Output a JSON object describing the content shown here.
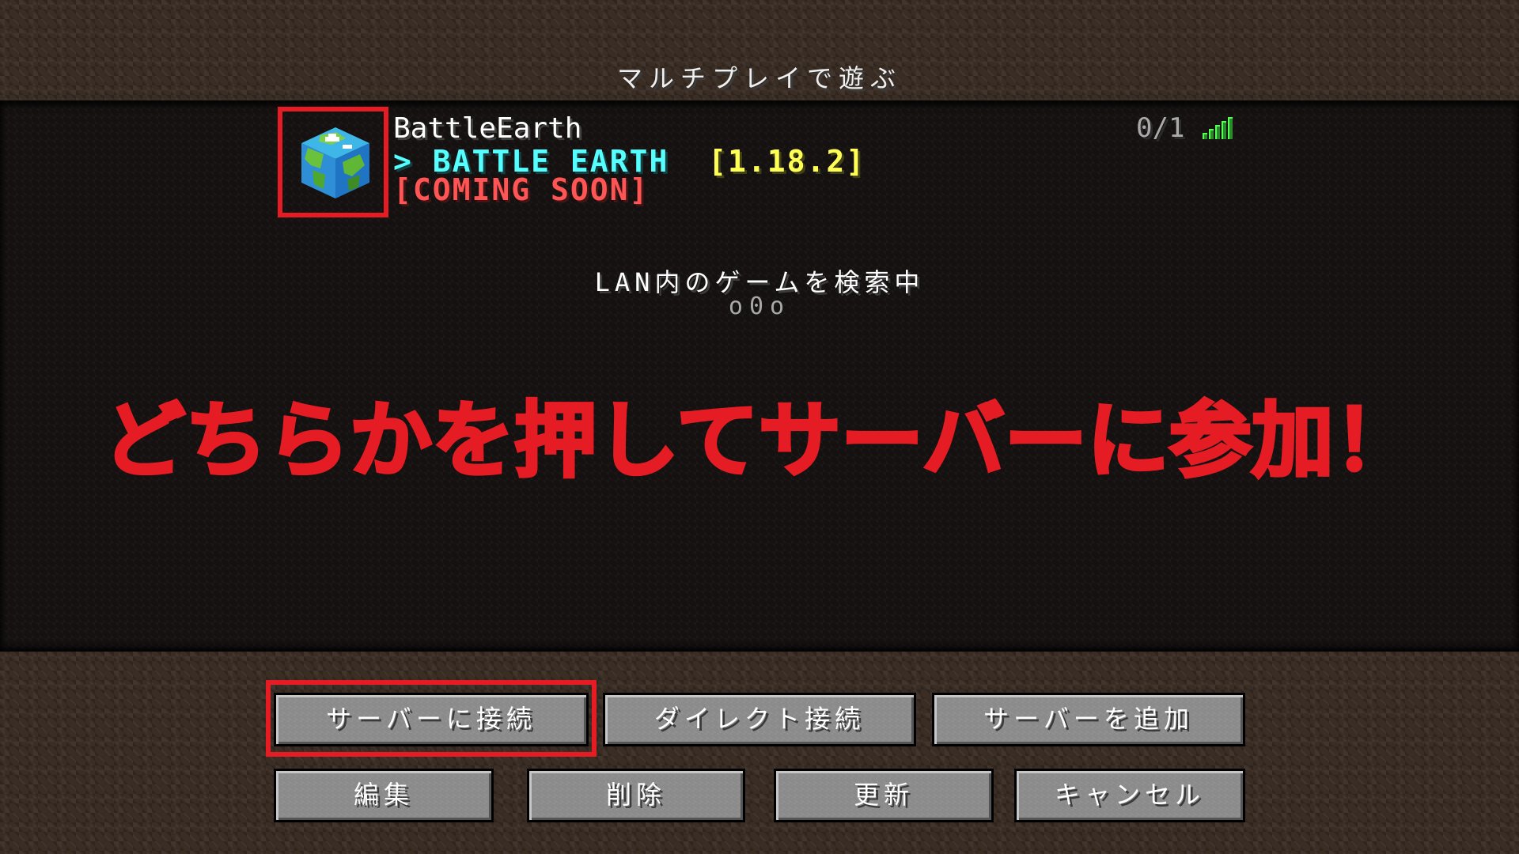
{
  "screen": {
    "title": "マルチプレイで遊ぶ"
  },
  "server_entry": {
    "name": "BattleEarth",
    "motd_arrow": ">",
    "motd_title": "BATTLE EARTH",
    "motd_version": "[1.18.2]",
    "motd_line2": "[COMING SOON]",
    "players": "0/1",
    "icon": "earth-cube-icon",
    "ping_icon": "signal-bars-icon",
    "colors": {
      "motd_aqua": "#55ffff",
      "motd_yellow": "#ffff55",
      "motd_red": "#ff5555",
      "ping_green": "#55ff55"
    }
  },
  "lan": {
    "scanning_text": "LAN内のゲームを検索中",
    "dots": "o0o"
  },
  "overlay": {
    "caption": "どちらかを押してサーバーに参加！",
    "highlight_color": "#e51c24"
  },
  "buttons": {
    "connect": "サーバーに接続",
    "direct_connect": "ダイレクト接続",
    "add_server": "サーバーを追加",
    "edit": "編集",
    "delete": "削除",
    "refresh": "更新",
    "cancel": "キャンセル"
  }
}
